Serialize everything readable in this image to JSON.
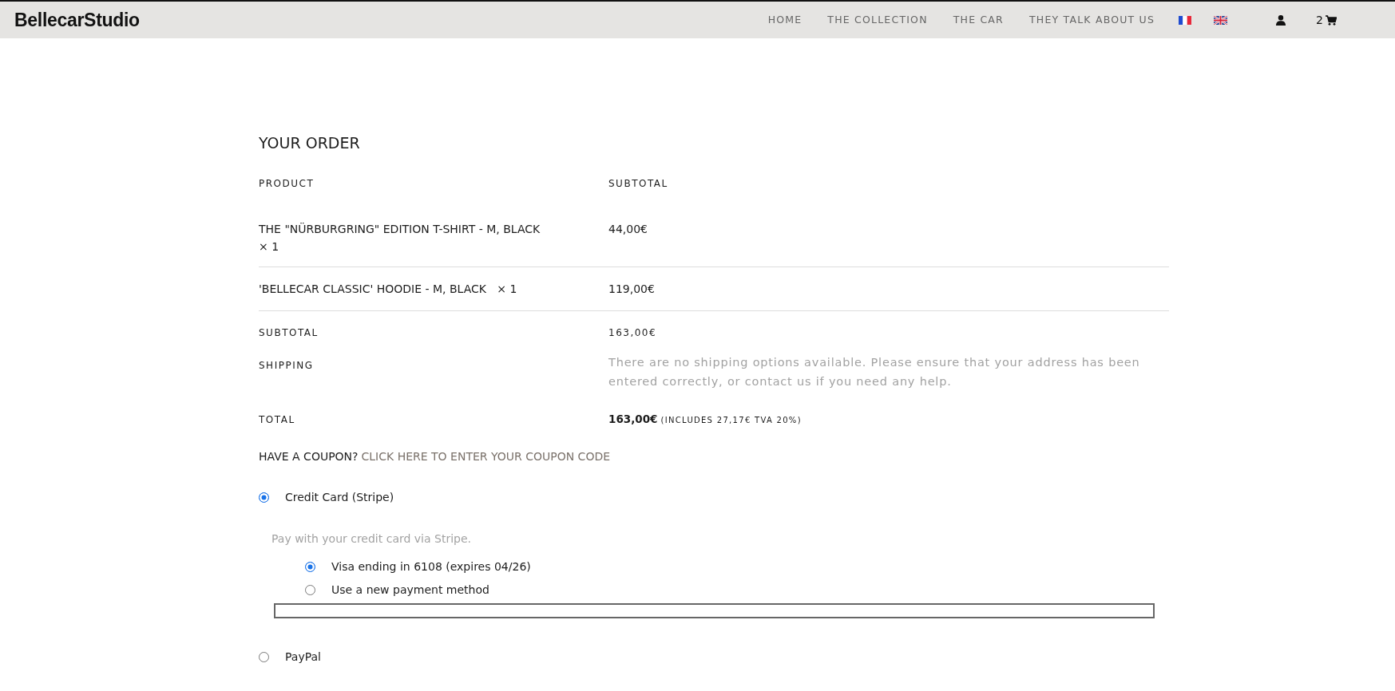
{
  "header": {
    "logo": "BellecarStudio",
    "nav": [
      {
        "label": "HOME"
      },
      {
        "label": "THE COLLECTION"
      },
      {
        "label": "THE CAR"
      },
      {
        "label": "THEY TALK ABOUT US"
      }
    ],
    "languages": [
      {
        "kind": "fr"
      },
      {
        "kind": "uk"
      }
    ],
    "cart_count": "2"
  },
  "order": {
    "title": "YOUR ORDER",
    "columns": [
      "PRODUCT",
      "SUBTOTAL"
    ],
    "items": [
      {
        "name": "THE \"NÜRBURGRING\" EDITION T-SHIRT - M, BLACK",
        "quantity": "× 1",
        "subtotal": "44,00€"
      },
      {
        "name": "'BELLECAR CLASSIC' HOODIE - M, BLACK",
        "quantity": "× 1",
        "subtotal": "119,00€"
      }
    ],
    "subtotal": {
      "label": "SUBTOTAL",
      "value": "163,00€"
    },
    "shipping": {
      "label": "SHIPPING",
      "message": "There are no shipping options available. Please ensure that your address has been entered correctly, or contact us if you need any help."
    },
    "total": {
      "label": "TOTAL",
      "value": "163,00€",
      "note": "(INCLUDES 27,17€ TVA 20%)"
    }
  },
  "coupon": {
    "prompt": "HAVE A COUPON?",
    "link": "CLICK HERE TO ENTER YOUR COUPON CODE"
  },
  "payment_methods": [
    {
      "label": "Credit Card (Stripe)",
      "selected": true,
      "description": "Pay with your credit card via Stripe.",
      "options": [
        {
          "label": "Visa ending in 6108 (expires 04/26)",
          "selected": true
        },
        {
          "label": "Use a new payment method",
          "selected": false
        }
      ]
    },
    {
      "label": "PayPal",
      "selected": false
    }
  ]
}
